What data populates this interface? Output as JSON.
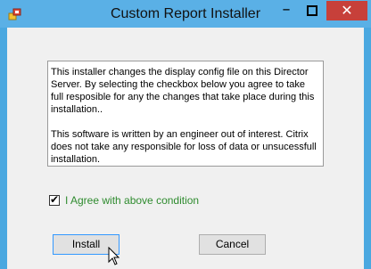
{
  "window": {
    "title": "Custom Report Installer",
    "controls": {
      "minimize": "–",
      "maximize": "□",
      "close": "✕"
    }
  },
  "notice": {
    "paragraph1": "This installer changes the display config file on this Director Server. By selecting the checkbox below you agree to take full resposible for any the changes that take place during this installation..",
    "paragraph2": "This software is written by an engineer out of interest. Citrix does not take any responsible for loss of data or unsucessfull installation."
  },
  "agree": {
    "label": "I Agree with above condition",
    "checked": true,
    "label_color": "#2e8b2e"
  },
  "buttons": {
    "install": "Install",
    "cancel": "Cancel"
  },
  "colors": {
    "titlebar": "#5ab0e6",
    "close_button": "#c7403a",
    "client": "#f0f0f0"
  }
}
